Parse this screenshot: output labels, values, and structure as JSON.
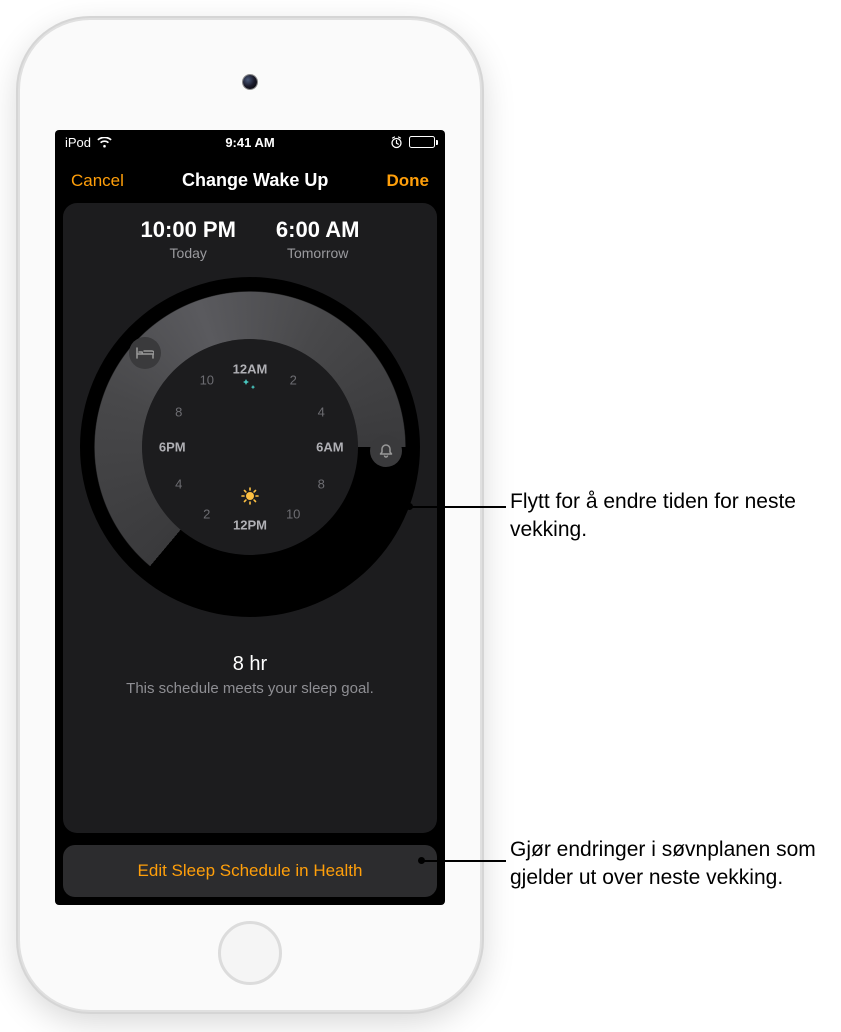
{
  "status_bar": {
    "carrier": "iPod",
    "time": "9:41 AM"
  },
  "nav": {
    "cancel": "Cancel",
    "title": "Change Wake Up",
    "done": "Done"
  },
  "schedule": {
    "bedtime": "10:00 PM",
    "bedtime_day": "Today",
    "wakeup": "6:00 AM",
    "wakeup_day": "Tomorrow"
  },
  "dial": {
    "hours": {
      "h0": "12AM",
      "h2": "2",
      "h4": "4",
      "h6": "6AM",
      "h8": "8",
      "h10": "10",
      "h12": "12PM",
      "h14": "2",
      "h16": "4",
      "h18": "6PM",
      "h20": "8",
      "h22": "10"
    }
  },
  "goal": {
    "duration": "8 hr",
    "message": "This schedule meets your sleep goal."
  },
  "edit_button": "Edit Sleep Schedule in Health",
  "callouts": {
    "c1": "Flytt for å endre tiden for neste vekking.",
    "c2": "Gjør endringer i søvnplanen som gjelder ut over neste vekking."
  }
}
